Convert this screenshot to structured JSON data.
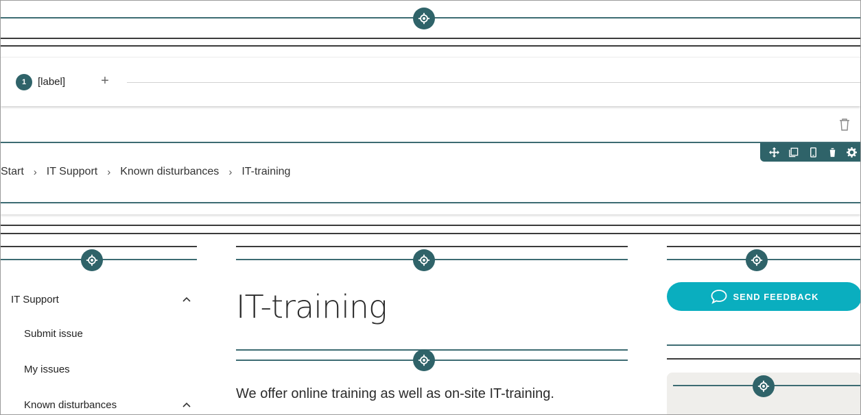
{
  "stepper": {
    "step_number": "1",
    "step_label": "[label]",
    "add_symbol": "+"
  },
  "breadcrumb": {
    "items": [
      "Start",
      "IT Support",
      "Known disturbances",
      "IT-training"
    ],
    "separator": "›"
  },
  "sidebar": {
    "items": [
      {
        "label": "IT Support",
        "expanded": true
      },
      {
        "label": "Submit issue"
      },
      {
        "label": "My issues"
      },
      {
        "label": "Known disturbances",
        "expanded": true
      }
    ]
  },
  "main": {
    "title": "IT-training",
    "intro": "We offer online training as well as on-site IT-training."
  },
  "feedback_button": {
    "label": "SEND FEEDBACK"
  },
  "toolbar": {
    "icons": [
      "move-icon",
      "copy-icon",
      "mobile-icon",
      "delete-icon",
      "settings-icon"
    ]
  },
  "colors": {
    "accent": "#2f6369",
    "button": "#0aaebf",
    "panel": "#efeeeb"
  }
}
